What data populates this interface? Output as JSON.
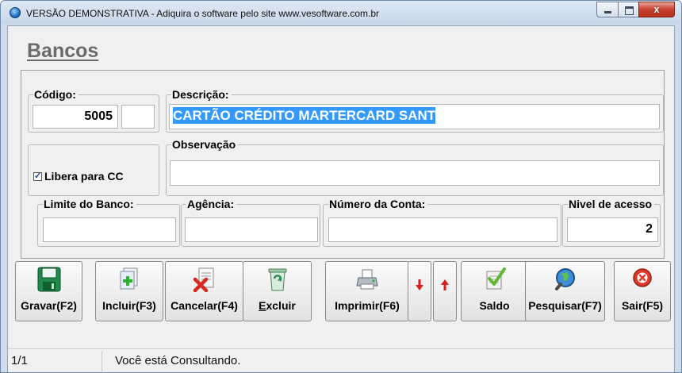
{
  "window": {
    "title": "VERSÃO DEMONSTRATIVA - Adiquira o software pelo site www.vesoftware.com.br",
    "controls": {
      "close_glyph": "x"
    }
  },
  "page": {
    "title": "Bancos"
  },
  "form": {
    "codigo": {
      "label": "Código:",
      "value": "5005",
      "suffix_value": ""
    },
    "descricao": {
      "label": "Descrição:",
      "value": "CARTÃO CRÉDITO MARTERCARD SANT"
    },
    "libera": {
      "label": "Libera para CC",
      "checked": true,
      "check_glyph": "✓"
    },
    "observacao": {
      "label": "Observação",
      "value": ""
    },
    "limite": {
      "label": "Limite do Banco:",
      "value": ""
    },
    "agencia": {
      "label": "Agência:",
      "value": ""
    },
    "conta": {
      "label": "Número da Conta:",
      "value": ""
    },
    "nivel": {
      "label": "Nivel de acesso",
      "value": "2"
    }
  },
  "buttons": {
    "gravar": {
      "label": "Gravar(F2)",
      "icon": "floppy-disk"
    },
    "incluir": {
      "label": "Incluir(F3)",
      "icon": "add-document"
    },
    "cancelar": {
      "label": "Cancelar(F4)",
      "icon": "cancel-document"
    },
    "excluir": {
      "label_first": "E",
      "label_rest": "xcluir",
      "icon": "recycle-bin"
    },
    "imprimir": {
      "label": "Imprimir(F6)",
      "icon": "printer"
    },
    "down": {
      "icon": "arrow-down-red"
    },
    "up": {
      "icon": "arrow-up-red"
    },
    "saldo": {
      "label": "Saldo",
      "icon": "checkmark-document"
    },
    "pesquisar": {
      "label": "Pesquisar(F7)",
      "icon": "magnifier-globe"
    },
    "sair": {
      "label": "Sair(F5)",
      "icon": "exit-red-circle"
    }
  },
  "status": {
    "record": "1/1",
    "message": "Você está Consultando."
  },
  "colors": {
    "selection": "#3399ff",
    "arrow_red": "#d81e1e",
    "accent_green": "#2e8b57"
  }
}
